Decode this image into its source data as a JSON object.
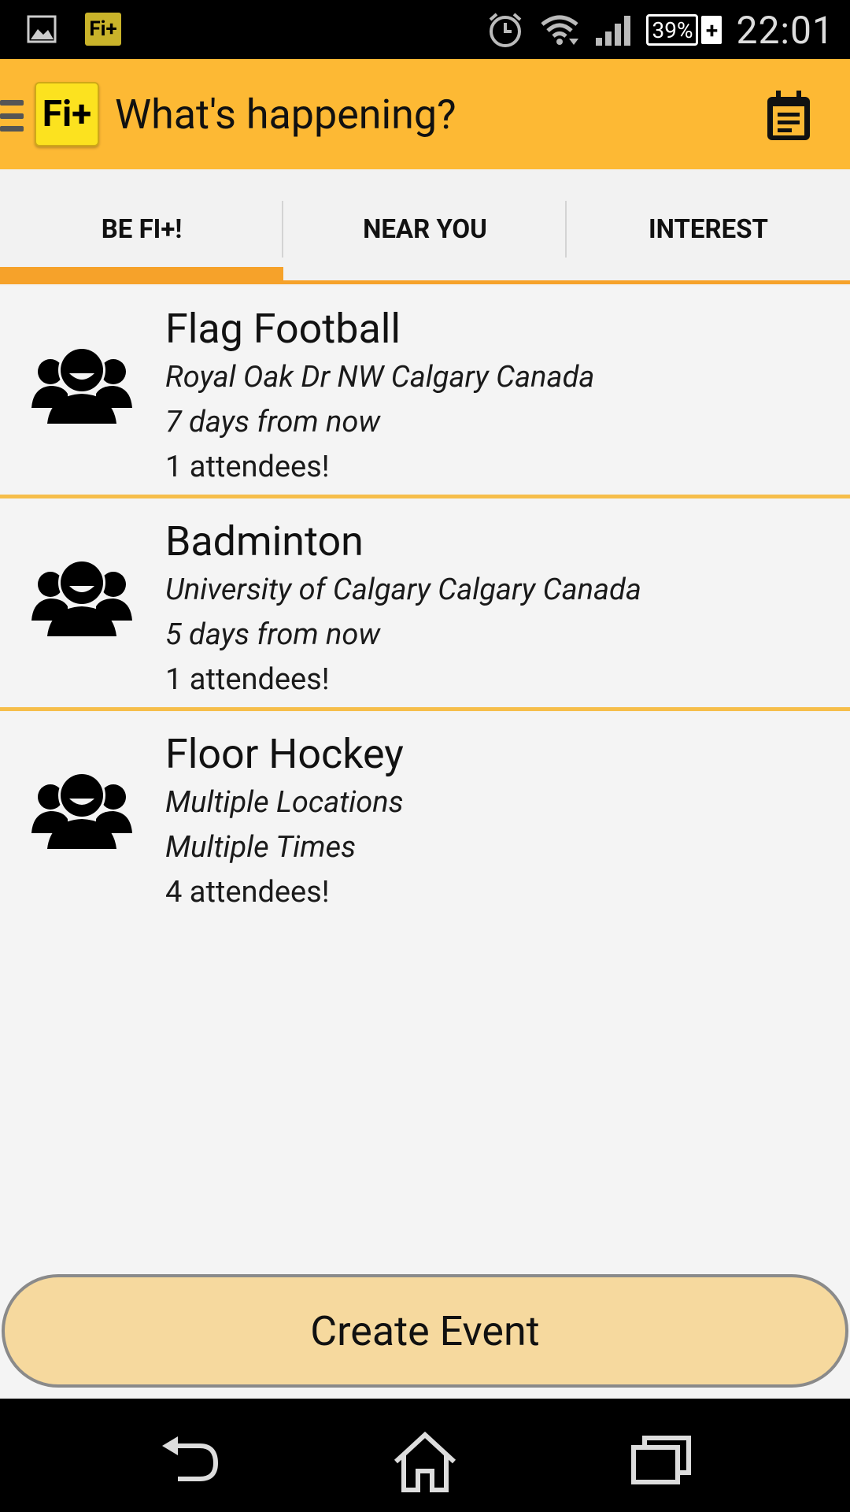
{
  "status_bar": {
    "notification_app_label": "Fi+",
    "battery_percent": "39%",
    "battery_charging_symbol": "+",
    "time": "22:01",
    "icons": [
      "image-icon",
      "fi-plus-notification-icon",
      "alarm-icon",
      "wifi-icon",
      "signal-icon",
      "battery-icon"
    ]
  },
  "app_bar": {
    "logo_text": "Fi+",
    "title": "What's happening?",
    "accent_color": "#fdb934"
  },
  "tabs": [
    {
      "label": "BE FI+!",
      "selected": true
    },
    {
      "label": "NEAR YOU",
      "selected": false
    },
    {
      "label": "INTEREST",
      "selected": false
    }
  ],
  "events": [
    {
      "title": "Flag Football",
      "location": "Royal Oak Dr NW Calgary Canada",
      "when": "7 days from now",
      "attendees": "1 attendees!",
      "icon": "group-icon"
    },
    {
      "title": "Badminton",
      "location": "University of Calgary Calgary Canada",
      "when": "5 days from now",
      "attendees": "1 attendees!",
      "icon": "group-icon"
    },
    {
      "title": "Floor Hockey",
      "location": "Multiple Locations",
      "when": "Multiple Times",
      "attendees": "4 attendees!",
      "icon": "group-icon"
    }
  ],
  "create_button": {
    "label": "Create Event"
  },
  "nav_bar": {
    "buttons": [
      "back-icon",
      "home-icon",
      "recent-apps-icon"
    ]
  }
}
